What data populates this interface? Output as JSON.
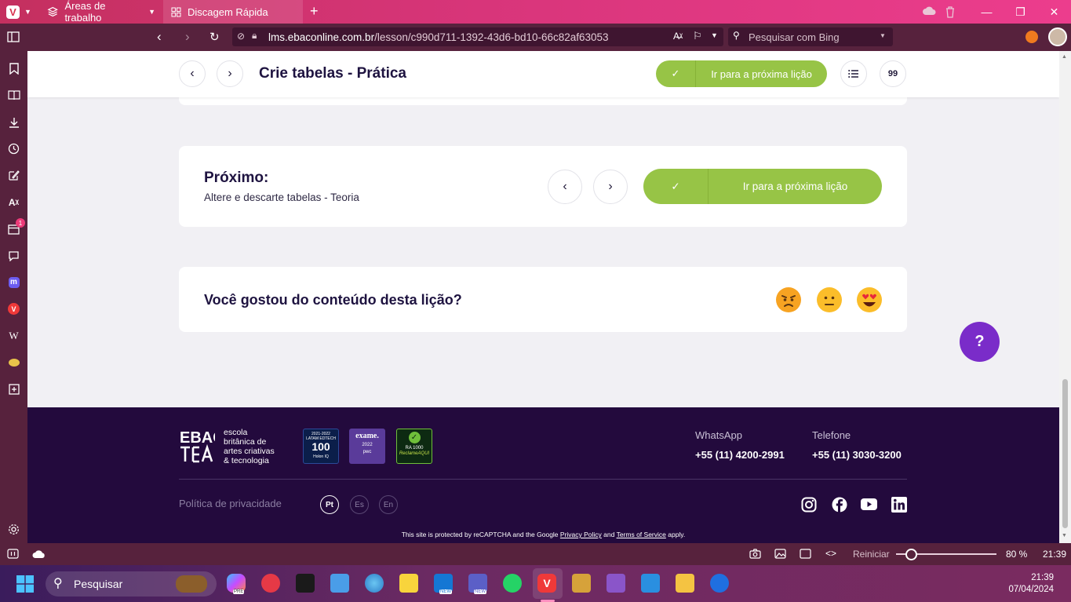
{
  "browser": {
    "tabs": [
      {
        "label": "Áreas de trabalho"
      },
      {
        "label": "Discagem Rápida"
      }
    ],
    "new_tab_symbol": "+",
    "url_host": "lms.ebaconline.com.br",
    "url_path": "/lesson/c990d711-1392-43d6-bd10-66c82af63053",
    "search_placeholder": "Pesquisar com Bing"
  },
  "sidepanel": {
    "icons": [
      "bookmark-icon",
      "reading-list-icon",
      "downloads-icon",
      "history-icon",
      "notes-icon",
      "translate-icon",
      "calendar-icon",
      "chat-icon",
      "mastodon-icon",
      "vivaldi-icon",
      "wikipedia-icon",
      "web-panel-icon",
      "add-panel-icon",
      "settings-icon"
    ],
    "calendar_badge": "1",
    "wikipedia_glyph": "W"
  },
  "lesson": {
    "title": "Crie tabelas - Prática",
    "next_button_label": "Ir para a próxima lição",
    "quote_glyph": "99"
  },
  "next_card": {
    "heading": "Próximo:",
    "subtitle": "Altere e descarte tabelas - Teoria",
    "button_label": "Ir para a próxima lição"
  },
  "rating_card": {
    "question": "Você gostou do conteúdo desta lição?",
    "options": [
      "angry-emoji",
      "neutral-emoji",
      "heart-eyes-emoji"
    ]
  },
  "help_button": {
    "label": "?"
  },
  "footer": {
    "logo_mark": "EBAC",
    "logo_lines": [
      "escola",
      "britânica de",
      "artes criativas",
      "& tecnologia"
    ],
    "awards": [
      {
        "lines": [
          "2021-2022",
          "LATAM EDTECH",
          "100",
          "Holon IQ"
        ]
      },
      {
        "lines": [
          "exame.",
          "2022",
          "pwc"
        ]
      },
      {
        "lines": [
          "RA 1000",
          "ReclameAQUI"
        ]
      }
    ],
    "contacts": [
      {
        "label": "WhatsApp",
        "value": "+55 (11) 4200-2991"
      },
      {
        "label": "Telefone",
        "value": "+55 (11) 3030-3200"
      }
    ],
    "privacy_link": "Política de privacidade",
    "languages": [
      "Pt",
      "Es",
      "En"
    ],
    "socials": [
      "instagram-icon",
      "facebook-icon",
      "youtube-icon",
      "linkedin-icon"
    ],
    "recaptcha_prefix": "This site is protected by reCAPTCHA and the Google ",
    "privacy_policy": "Privacy Policy",
    "and": " and ",
    "terms": "Terms of Service",
    "recaptcha_suffix": " apply."
  },
  "statusbar": {
    "reset_label": "Reiniciar",
    "zoom": "80 %",
    "zoom_fraction": 0.15,
    "time": "21:39"
  },
  "taskbar": {
    "search_placeholder": "Pesquisar",
    "apps": [
      "copilot-icon",
      "app-red-icon",
      "terminal-icon",
      "notepad-icon",
      "earth-icon",
      "sticky-notes-icon",
      "outlook-icon",
      "teams-icon",
      "whatsapp-icon",
      "vivaldi-icon",
      "office-icon",
      "visual-studio-icon",
      "vscode-icon",
      "file-explorer-icon",
      "maps-icon"
    ],
    "badge_new": "NEW",
    "badge_pre": "PRE",
    "time": "21:39",
    "date": "07/04/2024"
  },
  "colors": {
    "accent_green": "#97c446",
    "footer_bg": "#230a3d",
    "help_purple": "#7a2cc9",
    "browser_chrome": "#57223d"
  }
}
